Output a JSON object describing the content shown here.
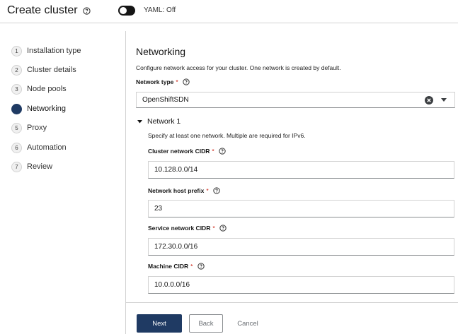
{
  "header": {
    "title": "Create cluster",
    "yaml_toggle_label": "YAML: Off"
  },
  "wizard": {
    "steps": [
      {
        "number": "1",
        "label": "Installation type",
        "current": false
      },
      {
        "number": "2",
        "label": "Cluster details",
        "current": false
      },
      {
        "number": "3",
        "label": "Node pools",
        "current": false
      },
      {
        "number": "4",
        "label": "Networking",
        "current": true
      },
      {
        "number": "5",
        "label": "Proxy",
        "current": false
      },
      {
        "number": "6",
        "label": "Automation",
        "current": false
      },
      {
        "number": "7",
        "label": "Review",
        "current": false
      }
    ]
  },
  "main": {
    "section_title": "Networking",
    "section_description": "Configure network access for your cluster. One network is created by default.",
    "network_type": {
      "label": "Network type",
      "required_mark": "*",
      "value": "OpenShiftSDN"
    },
    "network": {
      "title": "Network 1",
      "description": "Specify at least one network. Multiple are required for IPv6.",
      "fields": {
        "cluster_network_cidr": {
          "label": "Cluster network CIDR",
          "required_mark": "*",
          "value": "10.128.0.0/14"
        },
        "network_host_prefix": {
          "label": "Network host prefix",
          "required_mark": "*",
          "value": "23"
        },
        "service_network_cidr": {
          "label": "Service network CIDR",
          "required_mark": "*",
          "value": "172.30.0.0/16"
        },
        "machine_cidr": {
          "label": "Machine CIDR",
          "required_mark": "*",
          "value": "10.0.0.0/16"
        }
      }
    }
  },
  "footer": {
    "next_label": "Next",
    "back_label": "Back",
    "cancel_label": "Cancel"
  },
  "colors": {
    "primary": "#1f3a63",
    "required": "#c9190b",
    "border": "#d2d2d2"
  },
  "icons": {
    "title_help": "help-icon",
    "field_help": "help-icon",
    "clear": "clear-icon",
    "dropdown": "caret-down-icon",
    "expand": "caret-down-icon"
  }
}
